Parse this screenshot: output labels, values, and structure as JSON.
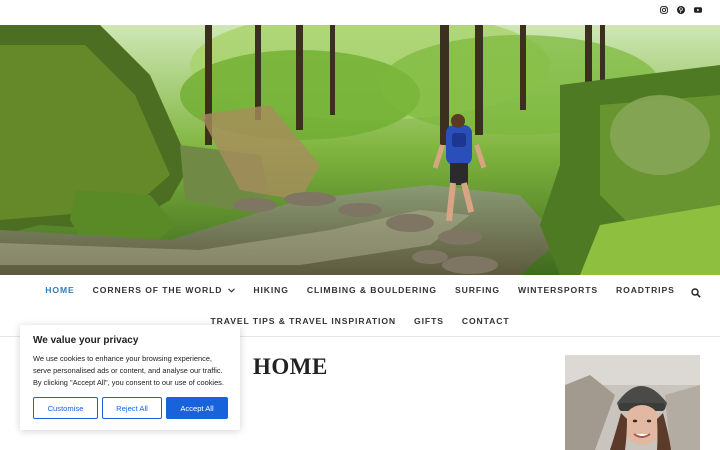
{
  "social": [
    {
      "icon": "instagram-icon"
    },
    {
      "icon": "pinterest-icon"
    },
    {
      "icon": "youtube-icon"
    }
  ],
  "nav": {
    "row1": [
      {
        "label": "Home",
        "active": true
      },
      {
        "label": "Corners of the World",
        "dropdown": true
      },
      {
        "label": "Hiking"
      },
      {
        "label": "Climbing & Bouldering"
      },
      {
        "label": "Surfing"
      },
      {
        "label": "Wintersports"
      },
      {
        "label": "Roadtrips"
      }
    ],
    "row2": [
      {
        "label": "Travel Tips & Travel Inspiration"
      },
      {
        "label": "Gifts"
      },
      {
        "label": "Contact"
      }
    ],
    "active_color": "#2f7fb2"
  },
  "main": {
    "title": "HOME"
  },
  "cookie": {
    "title": "We value your privacy",
    "text": "We use cookies to enhance your browsing experience, serve personalised ads or content, and analyse our traffic. By clicking \"Accept All\", you consent to our use of cookies.",
    "customise_label": "Customise",
    "reject_label": "Reject All",
    "accept_label": "Accept All",
    "accent": "#1863dc"
  }
}
